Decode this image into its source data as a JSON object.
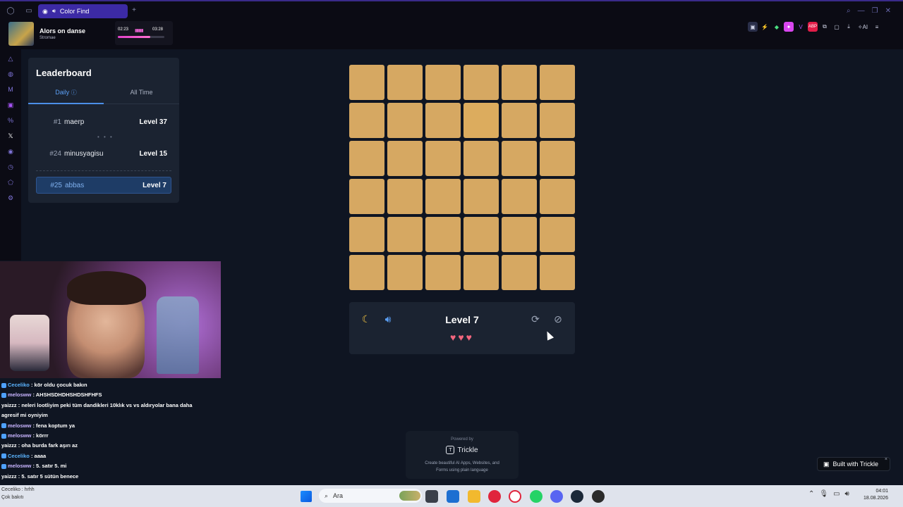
{
  "browser": {
    "tab_title": "Color Find",
    "new_tab_icon": "+"
  },
  "player": {
    "song_title": "Alors on danse",
    "artist": "Stromae",
    "time_elapsed": "02:23",
    "time_total": "03:28",
    "progress": 0.69
  },
  "leaderboard": {
    "title": "Leaderboard",
    "tab_daily": "Daily",
    "tab_alltime": "All Time",
    "rows": [
      {
        "rank": "#1",
        "name": "maerp",
        "level": "Level 37"
      },
      {
        "rank": "#24",
        "name": "minusyagisu",
        "level": "Level 15"
      },
      {
        "rank": "#25",
        "name": "abbas",
        "level": "Level 7"
      }
    ],
    "ellipsis": "• • •"
  },
  "game": {
    "grid_size": 6,
    "base_color": "#d6a862",
    "odd_color": "#dcac5e",
    "odd_cell_index": 9,
    "level_label": "Level 7",
    "hearts": "♥♥♥",
    "controls": [
      "moon-icon",
      "sound-icon",
      "refresh-icon",
      "eye-off-icon"
    ]
  },
  "powered": {
    "powered_by": "Powered by",
    "name": "Trickle",
    "logo_letter": "T",
    "desc": "Create beautiful AI Apps, Websites, and Forms using plain language"
  },
  "built_badge": {
    "label": "Built with Trickle",
    "close": "×"
  },
  "chat": [
    {
      "user": "Ceceliko",
      "user_color": "#5bb4ff",
      "msg": ": kör oldu çocuk bakın"
    },
    {
      "user": "melosww",
      "user_color": "#c8b4ff",
      "msg": ": AHSHSDHDHSHDSHFHFS"
    },
    {
      "user": "",
      "user_color": "#ffffff",
      "msg": "yaizzz : neleri lootliyim peki tüm dandikleri 10klık vs vs aldıryolar bana daha"
    },
    {
      "user": "",
      "user_color": "#ffffff",
      "msg": "agresif mi oyniyim"
    },
    {
      "user": "melosww",
      "user_color": "#c8b4ff",
      "msg": ": fena koptum ya"
    },
    {
      "user": "melosww",
      "user_color": "#c8b4ff",
      "msg": ": körrr"
    },
    {
      "user": "",
      "user_color": "#ffffff",
      "msg": "yaizzz : oha burda fark aşırı az"
    },
    {
      "user": "Ceceliko",
      "user_color": "#5bb4ff",
      "msg": ": aaaa"
    },
    {
      "user": "melosww",
      "user_color": "#c8b4ff",
      "msg": ": 5. satır 5. mi"
    },
    {
      "user": "",
      "user_color": "#ffffff",
      "msg": "yaizzz : 5. satır 5 sütün benece"
    }
  ],
  "taskbar": {
    "search_placeholder": "Ara",
    "time": "04:01",
    "date": "18.08.2026",
    "left_text_1": "Ceceliko : hrhh",
    "left_text_2": "Çok bakıtı"
  }
}
